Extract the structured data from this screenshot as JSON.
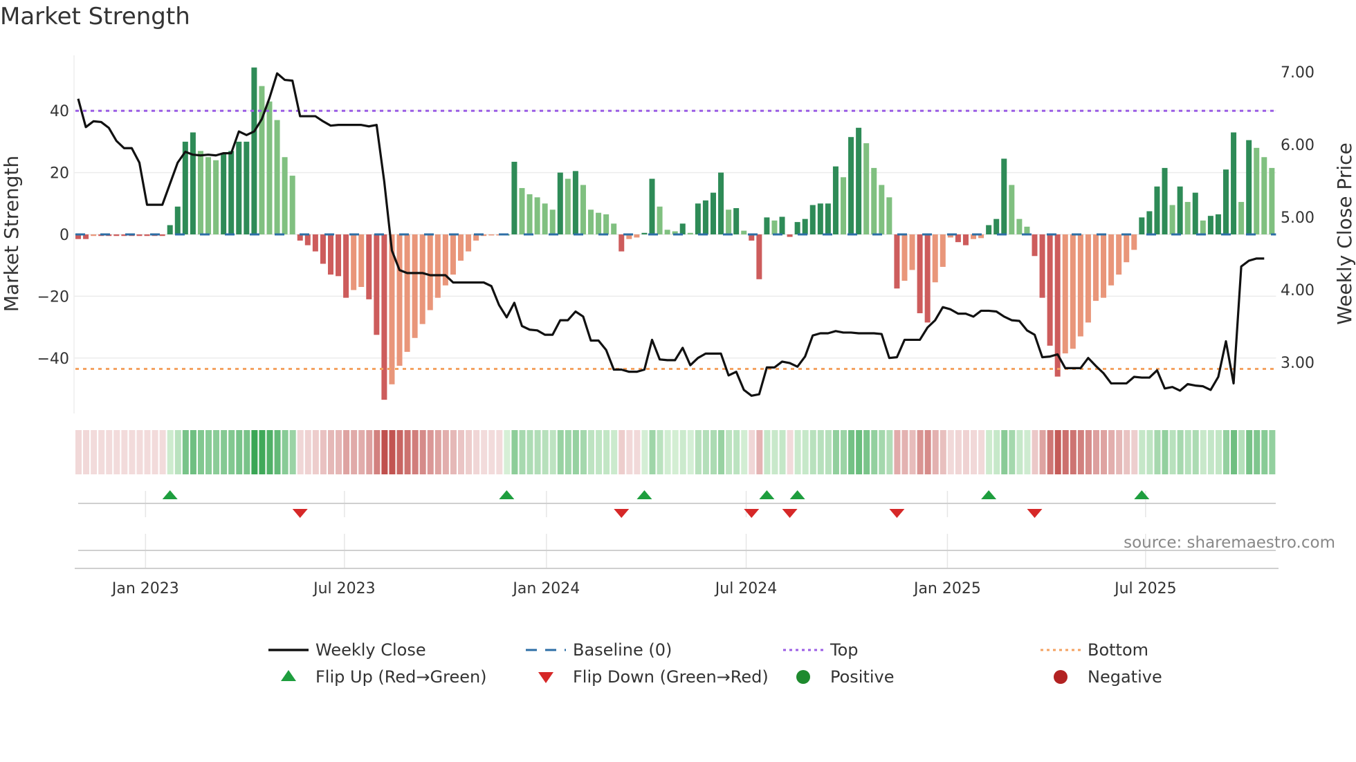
{
  "title": "Market Strength",
  "source": "source: sharemaestro.com",
  "chart_data": {
    "type": "bar",
    "title": "Market Strength",
    "ylabel": "Market Strength",
    "y2label": "Weekly Close Price",
    "ylim": [
      -58,
      58
    ],
    "y2lim": [
      2.4,
      7.2
    ],
    "yticks": [
      {
        "v": 40,
        "label": "40"
      },
      {
        "v": 20,
        "label": "20"
      },
      {
        "v": 0,
        "label": "0"
      },
      {
        "v": -20,
        "label": "−20"
      },
      {
        "v": -40,
        "label": "−40"
      }
    ],
    "y2ticks": [
      {
        "v": 7,
        "label": "7.00"
      },
      {
        "v": 6,
        "label": "6.00"
      },
      {
        "v": 5,
        "label": "5.00"
      },
      {
        "v": 4,
        "label": "4.00"
      },
      {
        "v": 3,
        "label": "3.00"
      }
    ],
    "xticks": [
      {
        "week": 8.8,
        "label": "Jan 2023"
      },
      {
        "week": 34.8,
        "label": "Jul 2023"
      },
      {
        "week": 61.2,
        "label": "Jan 2024"
      },
      {
        "week": 87.3,
        "label": "Jul 2024"
      },
      {
        "week": 113.6,
        "label": "Jan 2025"
      },
      {
        "week": 139.5,
        "label": "Jul 2025"
      }
    ],
    "top_level": 40,
    "bottom_level": -43.5,
    "strength": [
      -1.5,
      -1.5,
      -0.5,
      -0.5,
      -0.5,
      -0.5,
      -0.5,
      -0.5,
      -0.5,
      -0.5,
      -0.5,
      -0.5,
      3,
      9,
      30,
      33,
      27,
      25,
      24,
      26,
      27,
      30,
      30,
      54,
      48,
      43,
      37,
      25,
      19,
      -2,
      -3.5,
      -5.5,
      -9.5,
      -13,
      -13.5,
      -20.5,
      -18,
      -17,
      -21,
      -32.5,
      -53.5,
      -48.5,
      -42.5,
      -38,
      -33.5,
      -29,
      -24.5,
      -20.5,
      -16.5,
      -13,
      -8.5,
      -5.5,
      -2,
      -0.5,
      -0.3,
      -0.2,
      0,
      23.5,
      15,
      13,
      12,
      10,
      8,
      20,
      18,
      20.5,
      16,
      8,
      7,
      6.5,
      3.5,
      -5.5,
      -1.5,
      -1,
      0.5,
      18,
      9,
      1.5,
      1,
      3.5,
      0.5,
      10,
      11,
      13.5,
      20,
      8,
      8.5,
      1.2,
      -2,
      -14.5,
      5.5,
      4.5,
      5.7,
      -0.8,
      4,
      5,
      9.5,
      10,
      10,
      22,
      18.5,
      31.5,
      34.5,
      29.5,
      21.5,
      16,
      12,
      -17.5,
      -15,
      -11.5,
      -25.5,
      -28.5,
      -15.5,
      -10.5,
      -1,
      -2.5,
      -3.5,
      -1.5,
      -1.2,
      3,
      5,
      24.5,
      16,
      5,
      2.5,
      -7,
      -20.5,
      -36,
      -46,
      -38.5,
      -37,
      -33,
      -28.5,
      -21.5,
      -20.5,
      -16.5,
      -13,
      -9,
      -5,
      5.5,
      7.5,
      15.5,
      21.5,
      9.5,
      15.5,
      10.5,
      13.5,
      4.5,
      6,
      6.5,
      21,
      33,
      10.5,
      30.5,
      28,
      25,
      21.5
    ],
    "weekly_close": [
      6.63,
      6.24,
      6.32,
      6.31,
      6.23,
      6.05,
      5.95,
      5.95,
      5.75,
      5.17,
      5.17,
      5.17,
      5.46,
      5.75,
      5.9,
      5.86,
      5.85,
      5.86,
      5.85,
      5.88,
      5.88,
      6.18,
      6.13,
      6.18,
      6.35,
      6.64,
      6.98,
      6.89,
      6.88,
      6.39,
      6.39,
      6.39,
      6.32,
      6.26,
      6.27,
      6.27,
      6.27,
      6.27,
      6.25,
      6.27,
      5.49,
      4.54,
      4.27,
      4.23,
      4.23,
      4.23,
      4.2,
      4.2,
      4.2,
      4.1,
      4.1,
      4.1,
      4.1,
      4.1,
      4.05,
      3.79,
      3.62,
      3.82,
      3.5,
      3.45,
      3.44,
      3.38,
      3.38,
      3.58,
      3.58,
      3.7,
      3.63,
      3.3,
      3.3,
      3.17,
      2.9,
      2.9,
      2.87,
      2.87,
      2.9,
      3.31,
      3.04,
      3.03,
      3.03,
      3.2,
      2.96,
      3.06,
      3.12,
      3.12,
      3.12,
      2.82,
      2.87,
      2.62,
      2.54,
      2.56,
      2.93,
      2.93,
      3.01,
      2.99,
      2.94,
      3.08,
      3.37,
      3.4,
      3.4,
      3.43,
      3.41,
      3.41,
      3.4,
      3.4,
      3.4,
      3.39,
      3.06,
      3.07,
      3.31,
      3.31,
      3.31,
      3.48,
      3.58,
      3.76,
      3.73,
      3.67,
      3.67,
      3.63,
      3.71,
      3.71,
      3.7,
      3.63,
      3.58,
      3.57,
      3.44,
      3.38,
      3.07,
      3.08,
      3.11,
      2.92,
      2.92,
      2.92,
      3.06,
      2.95,
      2.85,
      2.71,
      2.71,
      2.71,
      2.8,
      2.79,
      2.79,
      2.89,
      2.64,
      2.66,
      2.61,
      2.7,
      2.68,
      2.67,
      2.62,
      2.8,
      3.29,
      2.71,
      4.32,
      4.4,
      4.43,
      4.43
    ],
    "flip_up_weeks": [
      12,
      56,
      74,
      90,
      94,
      119,
      139
    ],
    "flip_down_weeks": [
      29,
      71,
      88,
      93,
      107,
      125
    ],
    "legend": {
      "placement": "bottom",
      "items": [
        {
          "label": "Weekly Close",
          "kind": "line",
          "color": "#111111"
        },
        {
          "label": "Baseline (0)",
          "kind": "dash",
          "color": "#2c6ea6"
        },
        {
          "label": "Top",
          "kind": "dot",
          "color": "#9b5de5"
        },
        {
          "label": "Bottom",
          "kind": "dot",
          "color": "#f4a261"
        },
        {
          "label": "Flip Up (Red→Green)",
          "kind": "up",
          "color": "#1e9e3e"
        },
        {
          "label": "Flip Down (Green→Red)",
          "kind": "down",
          "color": "#d62828"
        },
        {
          "label": "Positive",
          "kind": "circle",
          "color": "#1e8a2e"
        },
        {
          "label": "Negative",
          "kind": "circle",
          "color": "#b22222"
        }
      ]
    },
    "colors": {
      "pos_up": "#2e8b57",
      "pos_down": "#80c080",
      "neg_down": "#cd5c5c",
      "neg_up": "#e9967a"
    }
  }
}
